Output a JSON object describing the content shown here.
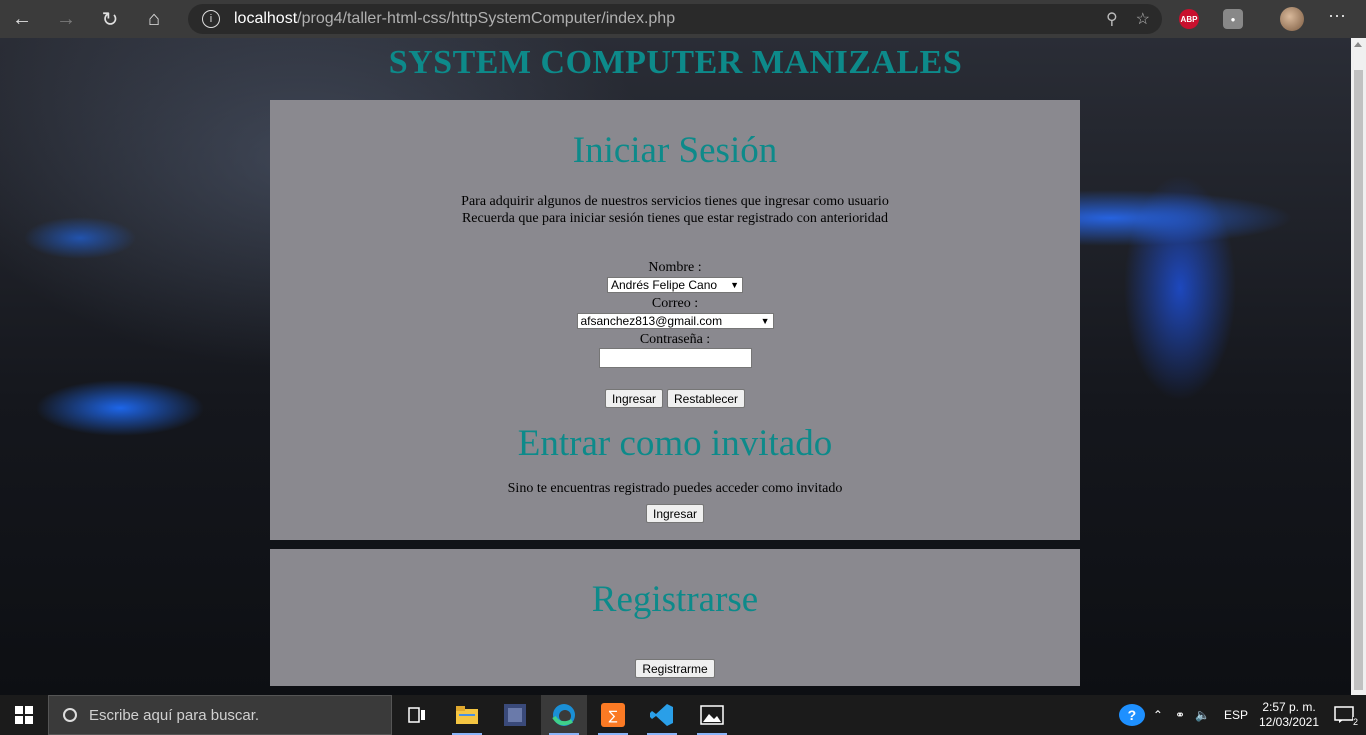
{
  "browser": {
    "host": "localhost",
    "path": "/prog4/taller-html-css/httpSystemComputer/index.php",
    "ext_abp": "ABP"
  },
  "site": {
    "title": "SYSTEM COMPUTER MANIZALES"
  },
  "login": {
    "heading": "Iniciar Sesión",
    "intro_line1": "Para adquirir algunos de nuestros servicios tienes que ingresar como usuario",
    "intro_line2": "Recuerda que para iniciar sesión tienes que estar registrado con anterioridad",
    "name_label": "Nombre :",
    "name_value": "Andrés Felipe Cano",
    "email_label": "Correo :",
    "email_value": "afsanchez813@gmail.com",
    "password_label": "Contraseña :",
    "password_value": "",
    "submit_label": "Ingresar",
    "reset_label": "Restablecer"
  },
  "guest": {
    "heading": "Entrar como invitado",
    "text": "Sino te encuentras registrado puedes acceder como invitado",
    "button_label": "Ingresar"
  },
  "register": {
    "heading": "Registrarse",
    "button_label": "Registrarme"
  },
  "taskbar": {
    "search_placeholder": "Escribe aquí para buscar.",
    "language": "ESP",
    "time": "2:57 p. m.",
    "date": "12/03/2021",
    "notification_count": "2"
  },
  "colors": {
    "accent": "#0d8a8a",
    "panel": "#8a898f"
  }
}
